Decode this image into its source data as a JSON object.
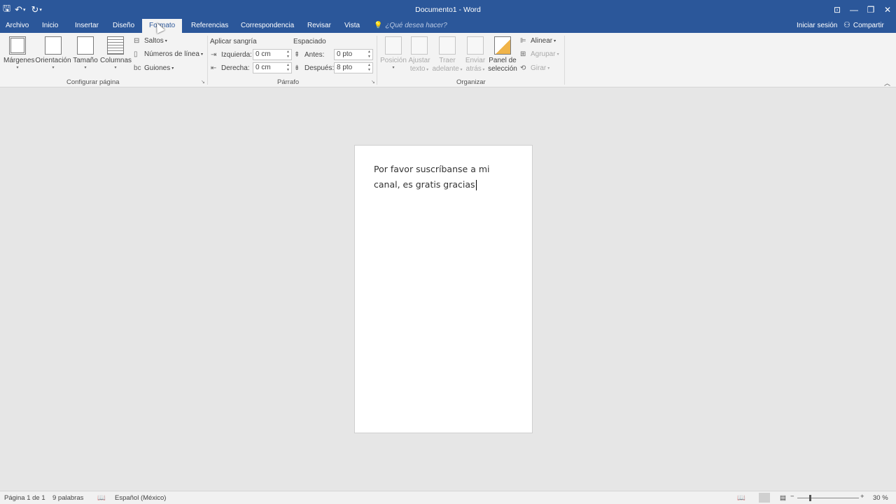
{
  "window": {
    "title": "Documento1 - Word",
    "controls": [
      "ribbon-display-icon",
      "minimize-icon",
      "restore-icon",
      "close-icon"
    ]
  },
  "quick_access": {
    "save_icon": "save-icon",
    "undo_icon": "undo-icon",
    "redo_icon": "redo-icon",
    "customize_icon": "customize-qat-icon"
  },
  "tabs": [
    {
      "label": "Archivo",
      "active": false
    },
    {
      "label": "Inicio",
      "active": false
    },
    {
      "label": "Insertar",
      "active": false
    },
    {
      "label": "Diseño",
      "active": false
    },
    {
      "label": "Formato",
      "active": true
    },
    {
      "label": "Referencias",
      "active": false
    },
    {
      "label": "Correspondencia",
      "active": false
    },
    {
      "label": "Revisar",
      "active": false
    },
    {
      "label": "Vista",
      "active": false
    }
  ],
  "tell_me": {
    "placeholder": "¿Qué desea hacer?"
  },
  "account": {
    "signin": "Iniciar sesión",
    "share": "Compartir"
  },
  "ribbon": {
    "configurar_pagina": {
      "label": "Configurar página",
      "margenes": "Márgenes",
      "orientacion": "Orientación",
      "tamano": "Tamaño",
      "columnas": "Columnas",
      "saltos": "Saltos",
      "numeros_linea": "Números de línea",
      "guiones": "Guiones"
    },
    "parrafo": {
      "label": "Párrafo",
      "aplicar_sangria": "Aplicar sangría",
      "izquierda_label": "Izquierda:",
      "izquierda_value": "0 cm",
      "derecha_label": "Derecha:",
      "derecha_value": "0 cm",
      "espaciado": "Espaciado",
      "antes_label": "Antes:",
      "antes_value": "0 pto",
      "despues_label": "Después:",
      "despues_value": "8 pto"
    },
    "organizar": {
      "label": "Organizar",
      "posicion": "Posición",
      "ajustar_texto_1": "Ajustar",
      "ajustar_texto_2": "texto",
      "traer_adelante_1": "Traer",
      "traer_adelante_2": "adelante",
      "enviar_atras_1": "Enviar",
      "enviar_atras_2": "atrás",
      "panel_seleccion_1": "Panel de",
      "panel_seleccion_2": "selección",
      "alinear": "Alinear",
      "agrupar": "Agrupar",
      "girar": "Girar"
    }
  },
  "document": {
    "line1": "Por favor suscríbanse a mi",
    "line2": "canal, es gratis  gracias"
  },
  "status": {
    "page": "Página 1 de 1",
    "words": "9 palabras",
    "language": "Español (México)",
    "zoom": "30 %"
  },
  "colors": {
    "word_blue": "#2b579a",
    "ribbon_bg": "#f3f3f3",
    "canvas_bg": "#e6e6e6"
  }
}
